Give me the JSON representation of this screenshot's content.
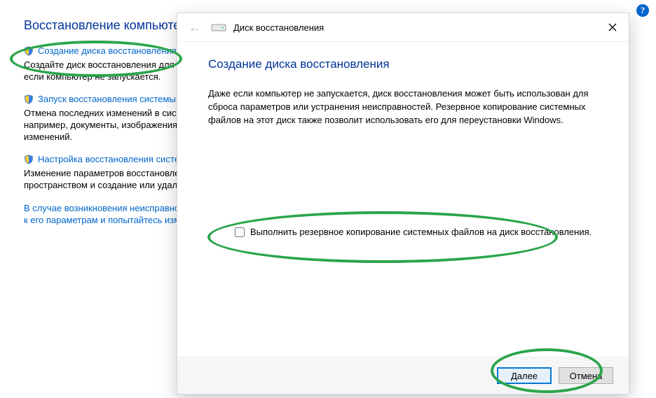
{
  "help_tooltip": "?",
  "page": {
    "title": "Восстановление компьютера",
    "tasks": [
      {
        "link": "Создание диска восстановления",
        "desc": "Создайте диск восстановления для устранения неполадок, даже если компьютер не запускается."
      },
      {
        "link": "Запуск восстановления системы",
        "desc": "Отмена последних изменений в системе, тогда как файлы, например, документы, изображения и музыка, остаются без изменений."
      },
      {
        "link": "Настройка восстановления системы",
        "desc": "Изменение параметров восстановления, управление дисковым пространством и создание или удаление точек восстановления."
      }
    ],
    "footnote": "В случае возникновения неисправностей компьютера перейдите к его параметрам и попытайтесь изменить их."
  },
  "dialog": {
    "back_label": "Назад",
    "title": "Диск восстановления",
    "close_label": "Закрыть",
    "heading": "Создание диска восстановления",
    "paragraph": "Даже если компьютер не запускается, диск восстановления может быть использован для сброса параметров или устранения неисправностей. Резервное копирование системных файлов на этот диск также позволит использовать его для переустановки Windows.",
    "checkbox_label": "Выполнить резервное копирование системных файлов на диск восстановления.",
    "next_button": "Далее",
    "cancel_button": "Отмена"
  }
}
